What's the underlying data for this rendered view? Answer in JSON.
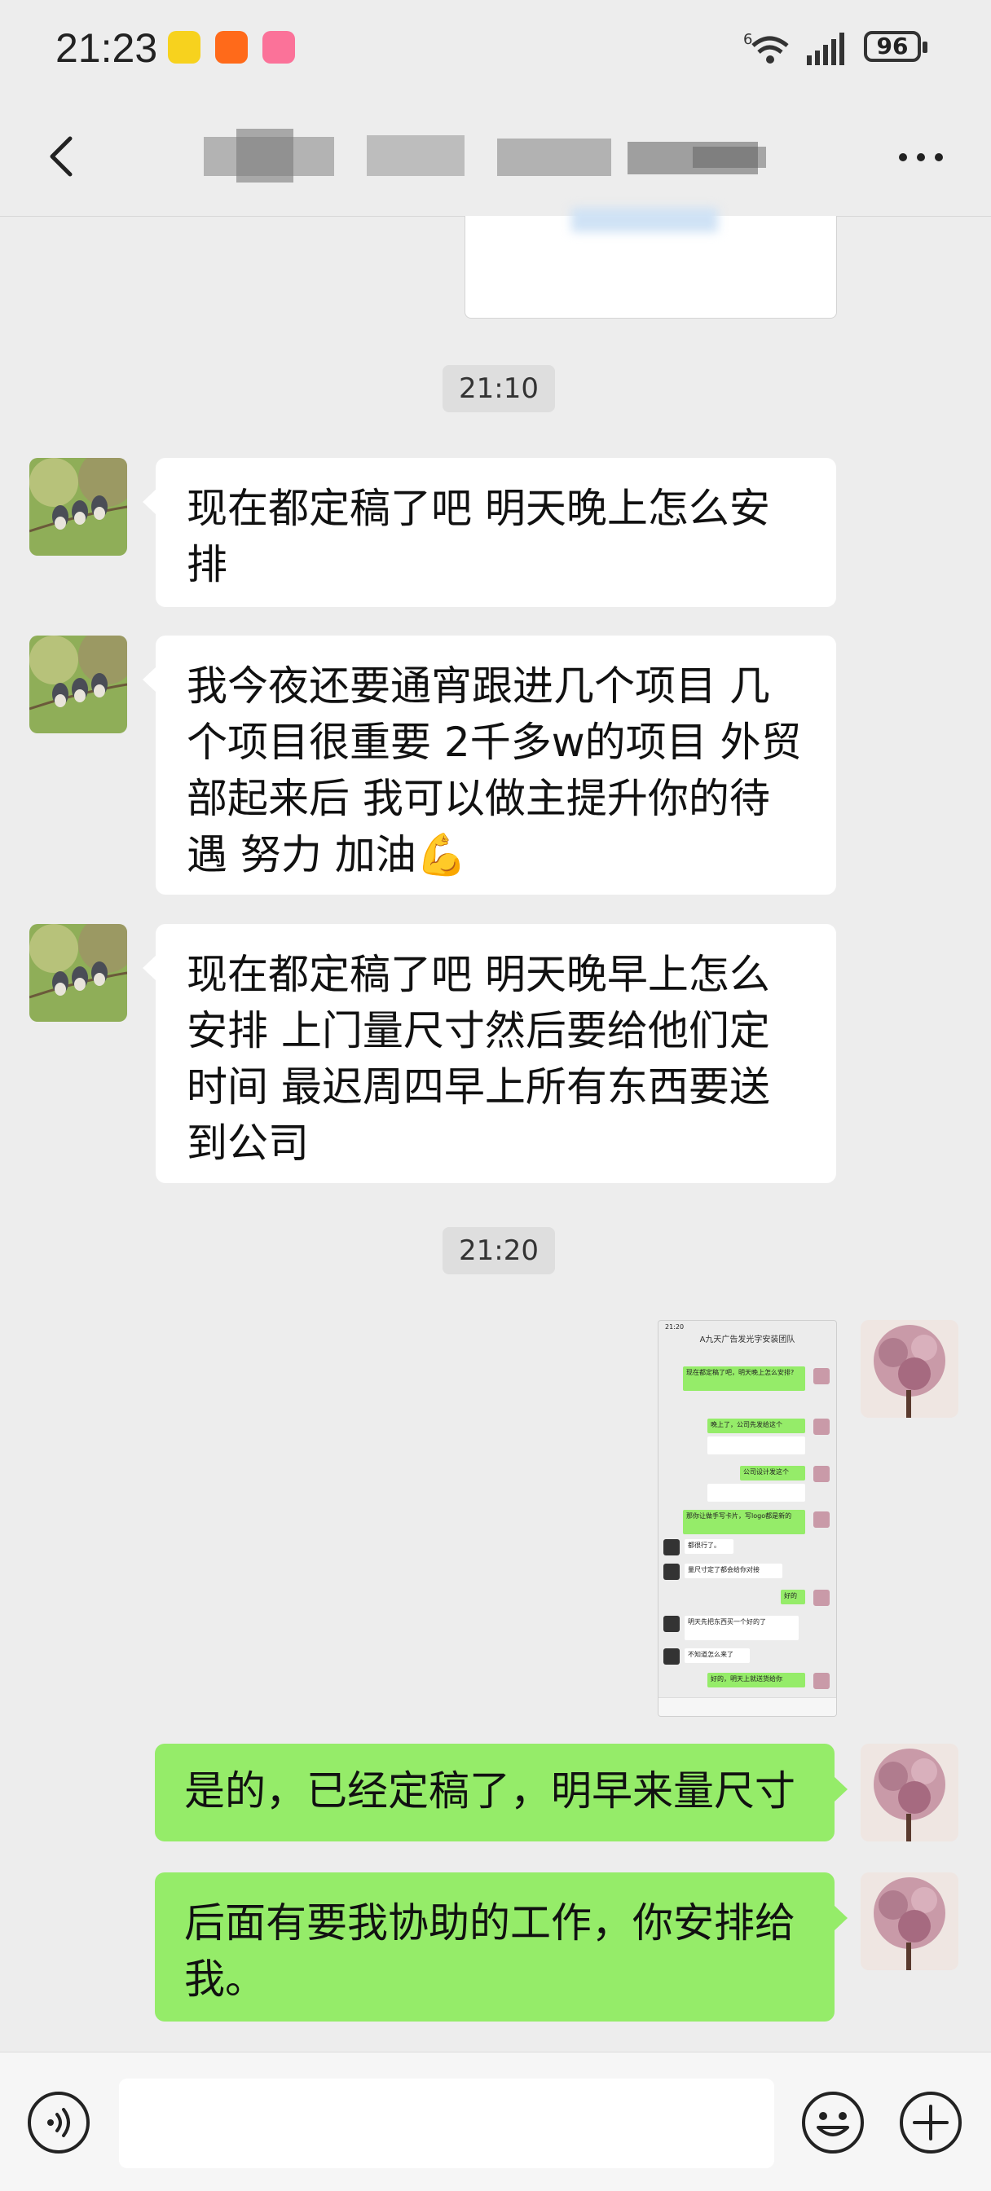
{
  "status_bar": {
    "time": "21:23",
    "battery": "96",
    "network": "6"
  },
  "header": {
    "title_blurred": true
  },
  "colors": {
    "background": "#ededed",
    "incoming_bubble": "#ffffff",
    "outgoing_bubble": "#95ec69"
  },
  "messages": [
    {
      "type": "timestamp",
      "text": "21:10"
    },
    {
      "type": "incoming",
      "text": "现在都定稿了吧  明天晚上怎么安排"
    },
    {
      "type": "incoming",
      "text": "我今夜还要通宵跟进几个项目  几个项目很重要  2千多w的项目  外贸部起来后  我可以做主提升你的待遇  努力  加油💪"
    },
    {
      "type": "incoming",
      "text": "现在都定稿了吧  明天晚早上怎么安排 上门量尺寸然后要给他们定时间  最迟周四早上所有东西要送到公司"
    },
    {
      "type": "timestamp",
      "text": "21:20"
    },
    {
      "type": "outgoing-image",
      "text": "screenshot"
    },
    {
      "type": "outgoing",
      "text": "是的，已经定稿了，明早来量尺寸"
    },
    {
      "type": "outgoing",
      "text": "后面有要我协助的工作，你安排给我。"
    }
  ],
  "thumbnail": {
    "time": "21:20",
    "title": "A九天广告发光字安装团队",
    "lines": [
      "现在都定稿了吧，明天晚上怎么安排?",
      "晚上了，公司先发给这个",
      "公司设计发这个",
      "那你让做手写卡片，写logo都是新的",
      "好的",
      "明天先把东西买一个好的了",
      "不知道怎么来了",
      "好的，明天上就送货给你"
    ]
  },
  "input_bar": {
    "icons": [
      "voice-icon",
      "emoji-icon",
      "plus-icon"
    ]
  }
}
